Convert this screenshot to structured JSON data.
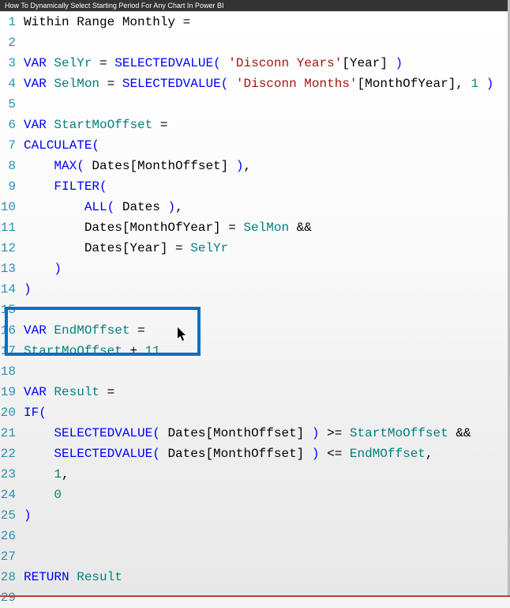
{
  "title": "How To Dynamically Select Starting Period For Any Chart In Power BI",
  "highlight": {
    "from": 16,
    "to": 17
  },
  "cursor": {
    "line": 16,
    "col": 26
  },
  "lines": {
    "1": {
      "n": "1",
      "tokens": [
        [
          "txt",
          "Within Range Monthly ="
        ]
      ]
    },
    "2": {
      "n": "2",
      "tokens": []
    },
    "3": {
      "n": "3",
      "tokens": [
        [
          "kw",
          "VAR"
        ],
        [
          "txt",
          " "
        ],
        [
          "var",
          "SelYr"
        ],
        [
          "txt",
          " = "
        ],
        [
          "fn",
          "SELECTEDVALUE"
        ],
        [
          "br",
          "("
        ],
        [
          "txt",
          " "
        ],
        [
          "str",
          "'Disconn Years'"
        ],
        [
          "txt",
          "[Year] "
        ],
        [
          "br",
          ")"
        ]
      ]
    },
    "4": {
      "n": "4",
      "tokens": [
        [
          "kw",
          "VAR"
        ],
        [
          "txt",
          " "
        ],
        [
          "var",
          "SelMon"
        ],
        [
          "txt",
          " = "
        ],
        [
          "fn",
          "SELECTEDVALUE"
        ],
        [
          "br",
          "("
        ],
        [
          "txt",
          " "
        ],
        [
          "str",
          "'Disconn Months'"
        ],
        [
          "txt",
          "[MonthOfYear], "
        ],
        [
          "num",
          "1"
        ],
        [
          "txt",
          " "
        ],
        [
          "br",
          ")"
        ]
      ]
    },
    "5": {
      "n": "5",
      "tokens": []
    },
    "6": {
      "n": "6",
      "tokens": [
        [
          "kw",
          "VAR"
        ],
        [
          "txt",
          " "
        ],
        [
          "var",
          "StartMoOffset"
        ],
        [
          "txt",
          " ="
        ]
      ]
    },
    "7": {
      "n": "7",
      "tokens": [
        [
          "fn",
          "CALCULATE"
        ],
        [
          "br",
          "("
        ]
      ]
    },
    "8": {
      "n": "8",
      "tokens": [
        [
          "txt",
          "    "
        ],
        [
          "fn",
          "MAX"
        ],
        [
          "br",
          "("
        ],
        [
          "txt",
          " Dates[MonthOffset] "
        ],
        [
          "br",
          ")"
        ],
        [
          "txt",
          ","
        ]
      ]
    },
    "9": {
      "n": "9",
      "tokens": [
        [
          "txt",
          "    "
        ],
        [
          "fn",
          "FILTER"
        ],
        [
          "br",
          "("
        ]
      ]
    },
    "10": {
      "n": "10",
      "tokens": [
        [
          "txt",
          "        "
        ],
        [
          "fn",
          "ALL"
        ],
        [
          "br",
          "("
        ],
        [
          "txt",
          " Dates "
        ],
        [
          "br",
          ")"
        ],
        [
          "txt",
          ","
        ]
      ]
    },
    "11": {
      "n": "11",
      "tokens": [
        [
          "txt",
          "        Dates[MonthOfYear] = "
        ],
        [
          "var",
          "SelMon"
        ],
        [
          "txt",
          " &&"
        ]
      ]
    },
    "12": {
      "n": "12",
      "tokens": [
        [
          "txt",
          "        Dates[Year] = "
        ],
        [
          "var",
          "SelYr"
        ]
      ]
    },
    "13": {
      "n": "13",
      "tokens": [
        [
          "txt",
          "    "
        ],
        [
          "br",
          ")"
        ]
      ]
    },
    "14": {
      "n": "14",
      "tokens": [
        [
          "br",
          ")"
        ]
      ]
    },
    "15": {
      "n": "15",
      "tokens": []
    },
    "16": {
      "n": "16",
      "tokens": [
        [
          "kw",
          "VAR"
        ],
        [
          "txt",
          " "
        ],
        [
          "var",
          "EndMOffset"
        ],
        [
          "txt",
          " ="
        ]
      ]
    },
    "17": {
      "n": "17",
      "tokens": [
        [
          "var",
          "StartMoOffset"
        ],
        [
          "txt",
          " + "
        ],
        [
          "num",
          "11"
        ]
      ]
    },
    "18": {
      "n": "18",
      "tokens": []
    },
    "19": {
      "n": "19",
      "tokens": [
        [
          "kw",
          "VAR"
        ],
        [
          "txt",
          " "
        ],
        [
          "var",
          "Result"
        ],
        [
          "txt",
          " ="
        ]
      ]
    },
    "20": {
      "n": "20",
      "tokens": [
        [
          "fn",
          "IF"
        ],
        [
          "br",
          "("
        ]
      ]
    },
    "21": {
      "n": "21",
      "tokens": [
        [
          "txt",
          "    "
        ],
        [
          "fn",
          "SELECTEDVALUE"
        ],
        [
          "br",
          "("
        ],
        [
          "txt",
          " Dates[MonthOffset] "
        ],
        [
          "br",
          ")"
        ],
        [
          "txt",
          " >= "
        ],
        [
          "var",
          "StartMoOffset"
        ],
        [
          "txt",
          " &&"
        ]
      ]
    },
    "22": {
      "n": "22",
      "tokens": [
        [
          "txt",
          "    "
        ],
        [
          "fn",
          "SELECTEDVALUE"
        ],
        [
          "br",
          "("
        ],
        [
          "txt",
          " Dates[MonthOffset] "
        ],
        [
          "br",
          ")"
        ],
        [
          "txt",
          " <= "
        ],
        [
          "var",
          "EndMOffset"
        ],
        [
          "txt",
          ","
        ]
      ]
    },
    "23": {
      "n": "23",
      "tokens": [
        [
          "txt",
          "    "
        ],
        [
          "num",
          "1"
        ],
        [
          "txt",
          ","
        ]
      ]
    },
    "24": {
      "n": "24",
      "tokens": [
        [
          "txt",
          "    "
        ],
        [
          "num",
          "0"
        ]
      ]
    },
    "25": {
      "n": "25",
      "tokens": [
        [
          "br",
          ")"
        ]
      ]
    },
    "26": {
      "n": "26",
      "tokens": []
    },
    "27": {
      "n": "27",
      "tokens": []
    },
    "28": {
      "n": "28",
      "tokens": [
        [
          "kw",
          "RETURN"
        ],
        [
          "txt",
          " "
        ],
        [
          "var",
          "Result"
        ]
      ]
    },
    "29": {
      "n": "29",
      "tokens": []
    }
  }
}
